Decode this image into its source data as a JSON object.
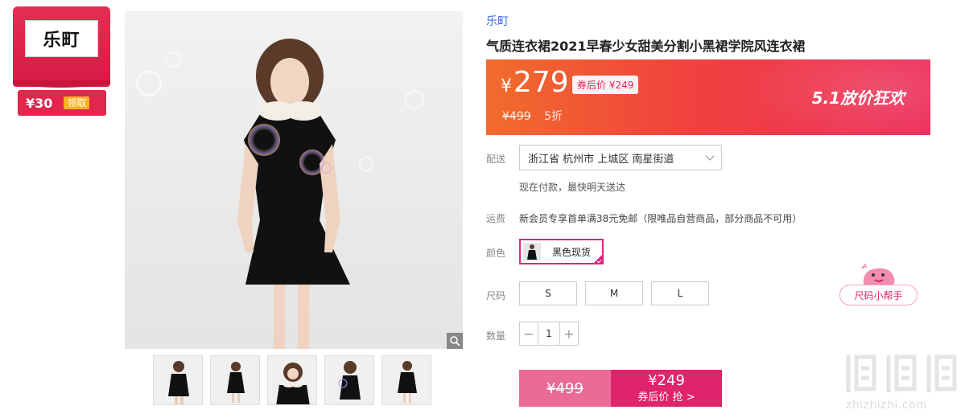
{
  "store": {
    "logo_text": "乐町",
    "coupon_amount": "¥30",
    "coupon_action": "领取"
  },
  "product": {
    "brand": "乐町",
    "title": "气质连衣裙2021早春少女甜美分割小黑裙学院风连衣裙"
  },
  "price": {
    "currency": "¥",
    "current": "279",
    "after_coupon": "券后价 ¥249",
    "original": "¥499",
    "discount": "5折",
    "promo": "5.1放价狂欢"
  },
  "delivery": {
    "label": "配送",
    "address": "浙江省 杭州市 上城区 南星街道",
    "note": "现在付款，最快明天送达"
  },
  "shipping_fee": {
    "label": "运费",
    "note": "新会员专享首单满38元免邮（限唯品自营商品，部分商品不可用）"
  },
  "color": {
    "label": "颜色",
    "selected": "黑色现货"
  },
  "size": {
    "label": "尺码",
    "options": [
      "S",
      "M",
      "L"
    ],
    "helper": "尺码小帮手"
  },
  "quantity": {
    "label": "数量",
    "value": "1",
    "minus": "−",
    "plus": "+"
  },
  "buy": {
    "original_price": "¥499",
    "price": "¥249",
    "action": "券后价 抢 >"
  },
  "watermark": {
    "text": "zhizhizhi.com"
  },
  "colors": {
    "accent": "#e0246c",
    "brand_link": "#3f6ed6",
    "banner_start": "#f06c2c",
    "banner_end": "#ec2e5c"
  }
}
